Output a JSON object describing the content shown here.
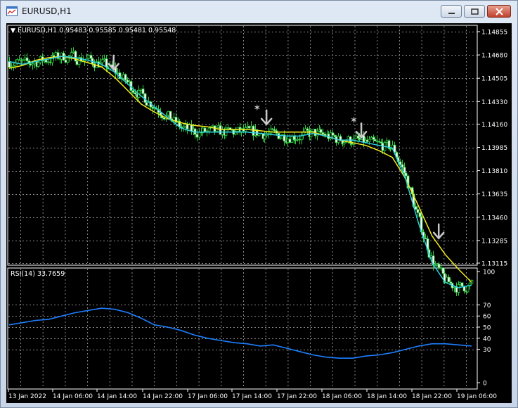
{
  "window": {
    "title": "EURUSD,H1"
  },
  "main_chart": {
    "header": "EURUSD,H1  0.95483 0.95585 0.95481 0.95548",
    "price_labels": [
      "1.14855",
      "1.14680",
      "1.14505",
      "1.14330",
      "1.14160",
      "1.13985",
      "1.13810",
      "1.13635",
      "1.13460",
      "1.13285",
      "1.13115"
    ],
    "price_min": 1.13115,
    "price_max": 1.14855
  },
  "rsi_panel": {
    "header": "RSI(14) 33.7659",
    "labels": [
      "100",
      "70",
      "60",
      "50",
      "40",
      "30",
      "0"
    ],
    "levels": [
      100,
      70,
      60,
      50,
      40,
      30,
      0
    ]
  },
  "time_axis": {
    "labels": [
      "13 Jan 2022",
      "14 Jan 06:00",
      "14 Jan 14:00",
      "14 Jan 22:00",
      "17 Jan 06:00",
      "17 Jan 14:00",
      "17 Jan 22:00",
      "18 Jan 06:00",
      "18 Jan 14:00",
      "18 Jan 22:00",
      "19 Jan 06:00"
    ]
  },
  "colors": {
    "bull_candle": "#000000",
    "bear_candle": "#ffffff",
    "candle_outline": "#2ecc40",
    "ma_fast": "#2fd0e0",
    "ma_slow": "#f2ea1a",
    "rsi_line": "#1e7fff",
    "grid": "#8a8a8a",
    "axis_text": "#ffffff",
    "arrow": "#c8c8c8"
  },
  "chart_data": {
    "type": "candlestick",
    "symbol": "EURUSD",
    "timeframe": "H1",
    "price_range": [
      1.13115,
      1.14855
    ],
    "ma_fast": [
      1.1463,
      1.1461,
      1.1463,
      1.1465,
      1.1467,
      1.1466,
      1.1464,
      1.1461,
      1.1455,
      1.1446,
      1.1437,
      1.1429,
      1.1421,
      1.1413,
      1.141,
      1.141,
      1.141,
      1.141,
      1.141,
      1.1409,
      1.1408,
      1.1407,
      1.1407,
      1.1409,
      1.1407,
      1.1404,
      1.1404,
      1.1402,
      1.14,
      1.1398,
      1.1375,
      1.1341,
      1.1312,
      1.1297,
      1.1293,
      1.1295
    ],
    "ma_slow": [
      1.1458,
      1.146,
      1.1464,
      1.1466,
      1.1467,
      1.1465,
      1.1462,
      1.1459,
      1.1451,
      1.1441,
      1.1431,
      1.1425,
      1.142,
      1.1417,
      1.1415,
      1.1414,
      1.1412,
      1.1412,
      1.1412,
      1.1411,
      1.141,
      1.141,
      1.141,
      1.141,
      1.1407,
      1.1404,
      1.1402,
      1.14,
      1.1396,
      1.1391,
      1.1375,
      1.1354,
      1.1332,
      1.1318,
      1.1307,
      1.1297
    ],
    "rsi": [
      52,
      54,
      56,
      57,
      60,
      63,
      65,
      67,
      66,
      63,
      58,
      52,
      50,
      47,
      43,
      40,
      38,
      36,
      35,
      33,
      34,
      31,
      28,
      25,
      23,
      22,
      22,
      24,
      25,
      27,
      30,
      33,
      35,
      35,
      34,
      33
    ],
    "arrows": [
      {
        "bar": 54,
        "type": "sell"
      },
      {
        "bar": 133,
        "type": "sell"
      },
      {
        "bar": 182,
        "type": "sell"
      },
      {
        "bar": 222,
        "type": "sell"
      }
    ],
    "stars": [
      {
        "bar": 128
      },
      {
        "bar": 178
      }
    ]
  }
}
